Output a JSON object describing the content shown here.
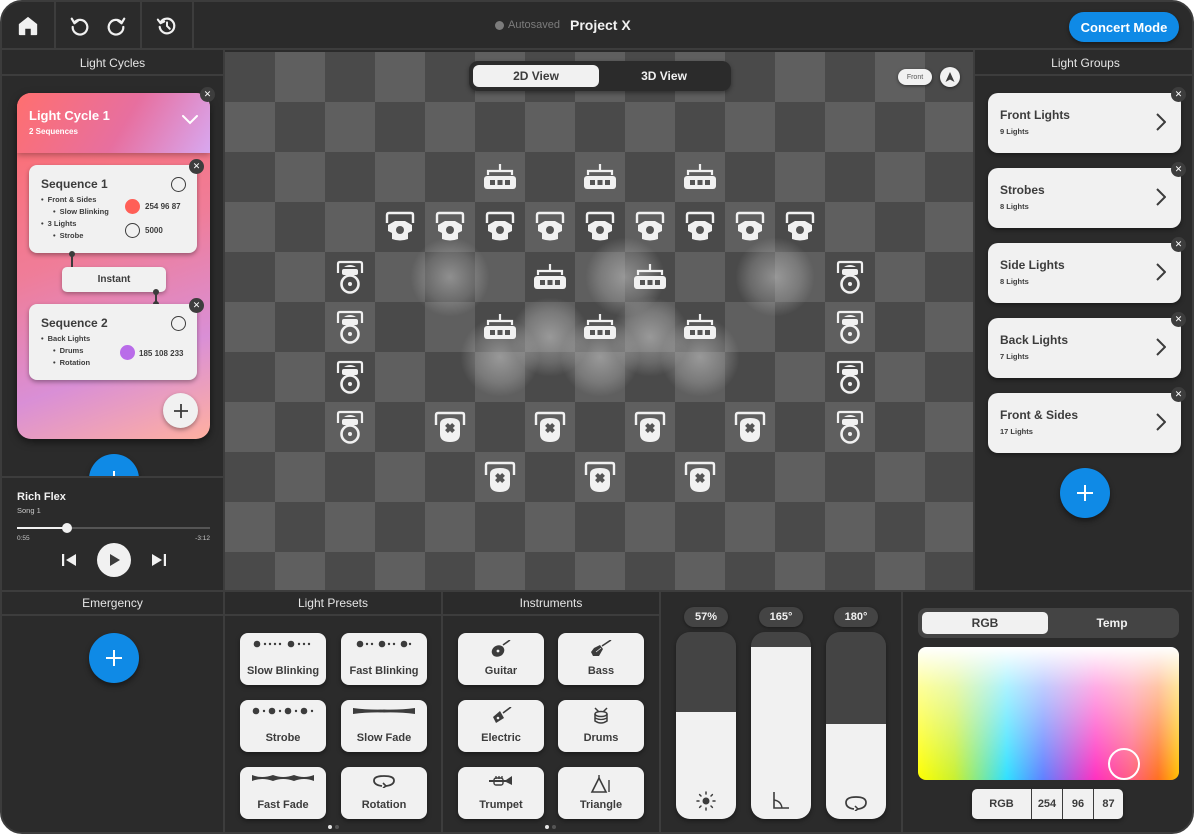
{
  "topbar": {
    "home_icon": "home-icon",
    "undo_icon": "undo-icon",
    "redo_icon": "redo-icon",
    "history_icon": "history-icon",
    "autosave_label": "Autosaved",
    "project_title": "Project X",
    "concert_mode_label": "Concert Mode"
  },
  "light_cycles": {
    "header": "Light Cycles",
    "cycle": {
      "title": "Light Cycle 1",
      "subtitle": "2 Sequences",
      "sequences": [
        {
          "title": "Sequence 1",
          "items": [
            {
              "level": 1,
              "text": "Front & Sides"
            },
            {
              "level": 2,
              "text": "Slow Blinking"
            },
            {
              "level": 1,
              "text": "3 Lights"
            },
            {
              "level": 2,
              "text": "Strobe"
            }
          ],
          "values": [
            {
              "swatch": "#ff5f57",
              "text": "254 96 87"
            },
            {
              "swatch": "radio",
              "text": "5000"
            }
          ]
        },
        {
          "title": "Sequence 2",
          "items": [
            {
              "level": 1,
              "text": "Back Lights"
            },
            {
              "level": 2,
              "text": "Drums"
            },
            {
              "level": 2,
              "text": "Rotation"
            }
          ],
          "values": [
            {
              "swatch": "#b96ce9",
              "text": "185 108 233"
            }
          ]
        }
      ],
      "transition_label": "Instant"
    }
  },
  "player": {
    "song_title": "Rich Flex",
    "song_subtitle": "Song 1",
    "elapsed": "0:55",
    "remaining": "-3:12",
    "progress": 0.26
  },
  "stage": {
    "view_tabs": [
      {
        "label": "2D View",
        "active": true
      },
      {
        "label": "3D View",
        "active": false
      }
    ],
    "orientation_label": "Front",
    "fixtures": [
      {
        "type": "bar",
        "col": 5,
        "row": 2
      },
      {
        "type": "bar",
        "col": 7,
        "row": 2
      },
      {
        "type": "bar",
        "col": 9,
        "row": 2
      },
      {
        "type": "spot",
        "col": 3,
        "row": 3
      },
      {
        "type": "spot",
        "col": 4,
        "row": 3
      },
      {
        "type": "spot",
        "col": 5,
        "row": 3
      },
      {
        "type": "spot",
        "col": 6,
        "row": 3
      },
      {
        "type": "spot",
        "col": 7,
        "row": 3
      },
      {
        "type": "spot",
        "col": 8,
        "row": 3
      },
      {
        "type": "spot",
        "col": 9,
        "row": 3
      },
      {
        "type": "spot",
        "col": 10,
        "row": 3
      },
      {
        "type": "spot",
        "col": 11,
        "row": 3
      },
      {
        "type": "side",
        "col": 2,
        "row": 4
      },
      {
        "type": "bar",
        "col": 6,
        "row": 4
      },
      {
        "type": "bar",
        "col": 8,
        "row": 4
      },
      {
        "type": "side",
        "col": 12,
        "row": 4
      },
      {
        "type": "side",
        "col": 2,
        "row": 5
      },
      {
        "type": "bar",
        "col": 5,
        "row": 5
      },
      {
        "type": "bar",
        "col": 7,
        "row": 5
      },
      {
        "type": "bar",
        "col": 9,
        "row": 5
      },
      {
        "type": "side",
        "col": 12,
        "row": 5
      },
      {
        "type": "side",
        "col": 2,
        "row": 6
      },
      {
        "type": "side",
        "col": 12,
        "row": 6
      },
      {
        "type": "side",
        "col": 2,
        "row": 7
      },
      {
        "type": "back",
        "col": 4,
        "row": 7
      },
      {
        "type": "back",
        "col": 6,
        "row": 7
      },
      {
        "type": "back",
        "col": 8,
        "row": 7
      },
      {
        "type": "back",
        "col": 10,
        "row": 7
      },
      {
        "type": "side",
        "col": 12,
        "row": 7
      },
      {
        "type": "back",
        "col": 5,
        "row": 8
      },
      {
        "type": "back",
        "col": 7,
        "row": 8
      },
      {
        "type": "back",
        "col": 9,
        "row": 8
      }
    ],
    "glows": [
      {
        "col": 4,
        "row": 4
      },
      {
        "col": 7.5,
        "row": 4
      },
      {
        "col": 10.5,
        "row": 4
      },
      {
        "col": 5,
        "row": 5.6
      },
      {
        "col": 7,
        "row": 5.6
      },
      {
        "col": 9,
        "row": 5.6
      },
      {
        "col": 6,
        "row": 5.2
      },
      {
        "col": 8,
        "row": 5.2
      }
    ]
  },
  "light_groups": {
    "header": "Light Groups",
    "items": [
      {
        "title": "Front Lights",
        "subtitle": "9 Lights"
      },
      {
        "title": "Strobes",
        "subtitle": "8 Lights"
      },
      {
        "title": "Side Lights",
        "subtitle": "8 Lights"
      },
      {
        "title": "Back Lights",
        "subtitle": "7 Lights"
      },
      {
        "title": "Front & Sides",
        "subtitle": "17 Lights"
      }
    ]
  },
  "emergency": {
    "header": "Emergency"
  },
  "light_presets": {
    "header": "Light Presets",
    "items": [
      {
        "label": "Slow Blinking",
        "icon": "slow-blink-pattern-icon"
      },
      {
        "label": "Fast Blinking",
        "icon": "fast-blink-pattern-icon"
      },
      {
        "label": "Strobe",
        "icon": "strobe-pattern-icon"
      },
      {
        "label": "Slow Fade",
        "icon": "slow-fade-wave-icon"
      },
      {
        "label": "Fast Fade",
        "icon": "fast-fade-wave-icon"
      },
      {
        "label": "Rotation",
        "icon": "rotation-icon"
      }
    ],
    "page": 1,
    "pages": 2
  },
  "instruments": {
    "header": "Instruments",
    "items": [
      {
        "label": "Guitar",
        "icon": "guitar-icon"
      },
      {
        "label": "Bass",
        "icon": "bass-guitar-icon"
      },
      {
        "label": "Electric",
        "icon": "electric-guitar-icon"
      },
      {
        "label": "Drums",
        "icon": "drum-icon"
      },
      {
        "label": "Trumpet",
        "icon": "trumpet-icon"
      },
      {
        "label": "Triangle",
        "icon": "triangle-instrument-icon"
      }
    ],
    "page": 1,
    "pages": 2
  },
  "sliders": [
    {
      "name": "brightness",
      "label": "57%",
      "fraction": 0.57,
      "icon": "brightness-icon"
    },
    {
      "name": "angle",
      "label": "165°",
      "fraction": 0.92,
      "icon": "angle-icon"
    },
    {
      "name": "rotation",
      "label": "180°",
      "fraction": 0.51,
      "icon": "rotation-icon"
    }
  ],
  "color": {
    "tabs": [
      {
        "label": "RGB",
        "active": true
      },
      {
        "label": "Temp",
        "active": false
      }
    ],
    "mode_label": "RGB",
    "r": "254",
    "g": "96",
    "b": "87",
    "selected_hex": "#fe6057"
  }
}
